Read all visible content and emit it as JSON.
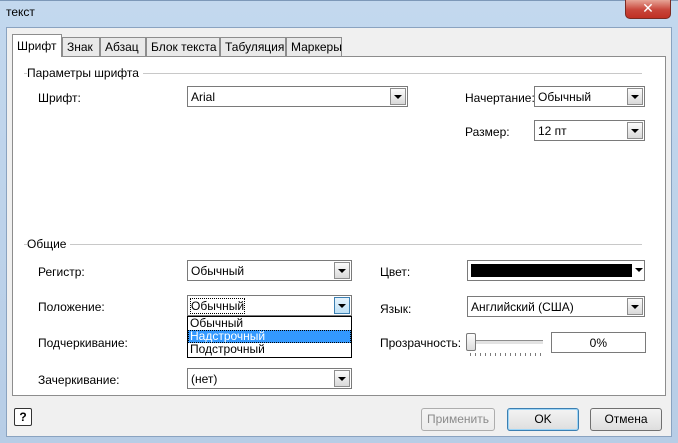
{
  "window": {
    "title": "текст",
    "close_glyph": "✕"
  },
  "tabs": [
    {
      "label": "Шрифт",
      "active": true
    },
    {
      "label": "Знак"
    },
    {
      "label": "Абзац"
    },
    {
      "label": "Блок текста"
    },
    {
      "label": "Табуляция"
    },
    {
      "label": "Маркеры"
    }
  ],
  "font_params": {
    "group_label": "Параметры шрифта",
    "font_label": "Шрифт:",
    "font_value": "Arial",
    "style_label": "Начертание:",
    "style_value": "Обычный",
    "size_label": "Размер:",
    "size_value": "12 пт"
  },
  "general": {
    "group_label": "Общие",
    "case_label": "Регистр:",
    "case_value": "Обычный",
    "position_label": "Положение:",
    "position_value": "Обычный",
    "position_options": [
      "Обычный",
      "Надстрочный",
      "Подстрочный"
    ],
    "position_highlighted": "Надстрочный",
    "underline_label": "Подчеркивание:",
    "strikethrough_label": "Зачеркивание:",
    "strikethrough_value": "(нет)",
    "color_label": "Цвет:",
    "color_value": "#000000",
    "language_label": "Язык:",
    "language_value": "Английский (США)",
    "transparency_label": "Прозрачность:",
    "transparency_value": "0%",
    "transparency_level": 0
  },
  "buttons": {
    "help": "?",
    "apply": "Применить",
    "ok": "OK",
    "cancel": "Отмена"
  }
}
